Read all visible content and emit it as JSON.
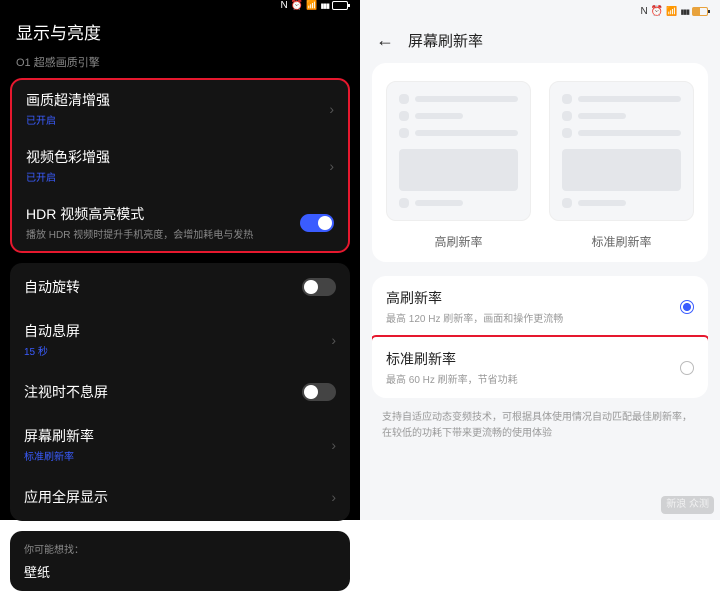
{
  "left": {
    "title": "显示与亮度",
    "section_label": "O1 超感画质引擎",
    "group1": [
      {
        "title": "画质超清增强",
        "sub": "已开启",
        "sub_on": true,
        "end": "chev"
      },
      {
        "title": "视频色彩增强",
        "sub": "已开启",
        "sub_on": true,
        "end": "chev"
      },
      {
        "title": "HDR 视频高亮模式",
        "sub": "播放 HDR 视频时提升手机亮度，会增加耗电与发热",
        "sub_on": false,
        "end": "toggle-on"
      }
    ],
    "group2": [
      {
        "title": "自动旋转",
        "end": "toggle-off"
      },
      {
        "title": "自动息屏",
        "sub": "15 秒",
        "sub_on": true,
        "end": "chev"
      },
      {
        "title": "注视时不息屏",
        "end": "toggle-off"
      },
      {
        "title": "屏幕刷新率",
        "sub": "标准刷新率",
        "sub_on": true,
        "end": "chev"
      },
      {
        "title": "应用全屏显示",
        "end": "chev"
      }
    ],
    "footer_label": "你可能想找：",
    "footer_item": "壁纸"
  },
  "right": {
    "title": "屏幕刷新率",
    "ill_labels": [
      "高刷新率",
      "标准刷新率"
    ],
    "opts": [
      {
        "title": "高刷新率",
        "sub": "最高 120 Hz 刷新率，画面和操作更流畅",
        "selected": true,
        "hl": false
      },
      {
        "title": "标准刷新率",
        "sub": "最高 60 Hz 刷新率，节省功耗",
        "selected": false,
        "hl": true
      }
    ],
    "footnote": "支持自适应动态变频技术，可根据具体使用情况自动匹配最佳刷新率，在较低的功耗下带来更流畅的使用体验"
  },
  "watermark": "新浪\n众测"
}
